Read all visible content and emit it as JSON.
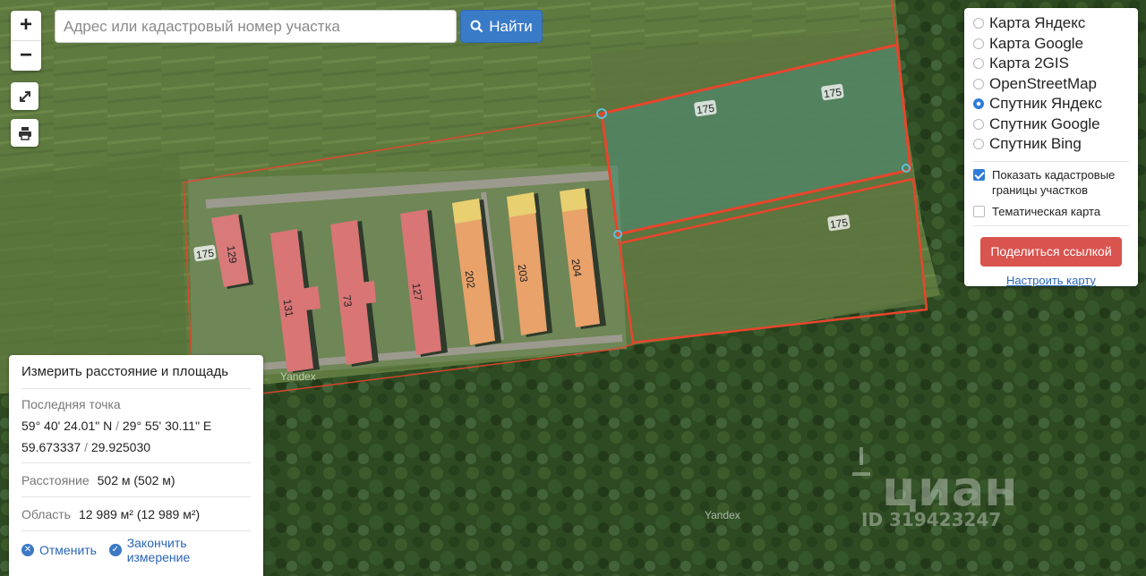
{
  "map": {
    "building_labels": [
      "129",
      "131",
      "73",
      "127",
      "202",
      "203",
      "204"
    ],
    "parcel_labels": [
      "175",
      "175",
      "175",
      "175"
    ],
    "provider_watermark": "Yandex",
    "cian_watermark": "циан",
    "cian_id": "ID 319423247",
    "colors": {
      "parcel_border": "#e8452c",
      "selected_parcel_fill": "#3aa7b5"
    }
  },
  "controls": {
    "zoom_in": "+",
    "zoom_out": "−",
    "fullscreen_icon": "fullscreen-icon",
    "print_icon": "printer-icon"
  },
  "search": {
    "placeholder": "Адрес или кадастровый номер участка",
    "value": "",
    "button_label": "Найти",
    "button_color": "#3a7bc8"
  },
  "layers": {
    "options": [
      {
        "label": "Карта Яндекс",
        "selected": false
      },
      {
        "label": "Карта Google",
        "selected": false
      },
      {
        "label": "Карта 2GIS",
        "selected": false
      },
      {
        "label": "OpenStreetMap",
        "selected": false
      },
      {
        "label": "Спутник Яндекс",
        "selected": true
      },
      {
        "label": "Спутник Google",
        "selected": false
      },
      {
        "label": "Спутник Bing",
        "selected": false
      }
    ],
    "show_cadastral": {
      "label": "Показать кадастровые границы участков",
      "checked": true
    },
    "thematic_map": {
      "label": "Тематическая карта",
      "checked": false
    },
    "share_button": "Поделиться ссылкой",
    "share_color": "#d9534f",
    "setup_link": "Настроить карту"
  },
  "measure": {
    "title": "Измерить расстояние и площадь",
    "last_point_label": "Последняя точка",
    "dms_lat": "59° 40' 24.01\" N",
    "dms_lon": "29° 55' 30.11\" E",
    "dec_lat": "59.673337",
    "dec_lon": "29.925030",
    "distance_label": "Расстояние",
    "distance_value": "502 м (502 м)",
    "area_label": "Область",
    "area_value": "12 989 м² (12 989 м²)",
    "cancel_label": "Отменить",
    "finish_label": "Закончить измерение"
  }
}
